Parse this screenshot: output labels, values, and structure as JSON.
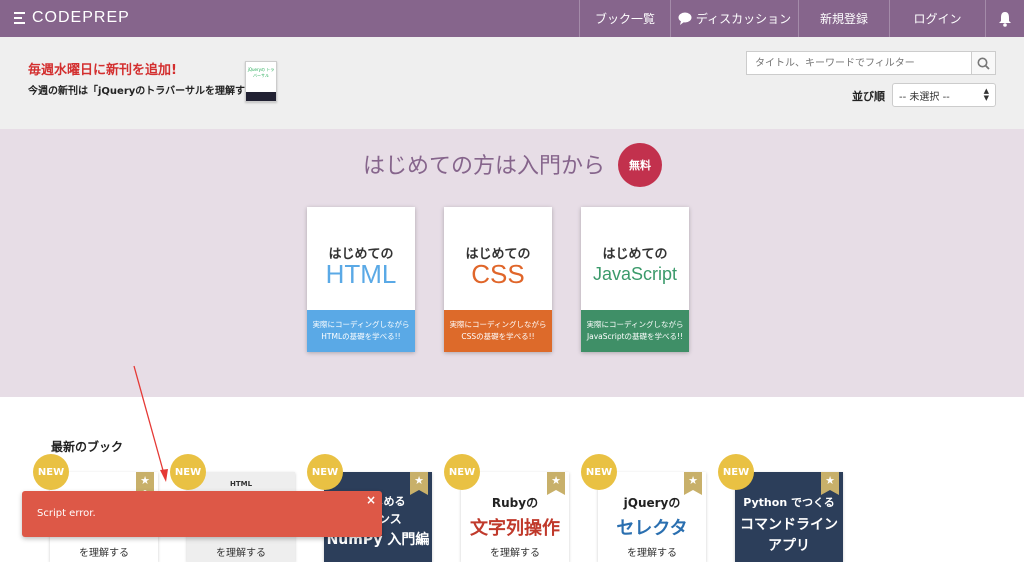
{
  "header": {
    "logo": "CODEPREP",
    "nav": [
      {
        "label": "ブック一覧"
      },
      {
        "label": "ディスカッション"
      },
      {
        "label": "新規登録"
      },
      {
        "label": "ログイン"
      }
    ]
  },
  "promo": {
    "title": "毎週水曜日に新刊を追加!",
    "subtitle": "今週の新刊は「jQueryのトラバーサルを理解する」",
    "book_cover_title": "jQueryの トラバーサル"
  },
  "search": {
    "placeholder": "タイトル、キーワードでフィルター"
  },
  "sort": {
    "label": "並び順",
    "selected": "-- 未選択 --"
  },
  "intro": {
    "title": "はじめての方は入門から",
    "badge": "無料",
    "courses": [
      {
        "prefix": "はじめての",
        "lang": "HTML",
        "desc1": "実際にコーディングしながら",
        "desc2": "HTMLの基礎を学べる!!",
        "color": "#5aa9e6",
        "band": "#5aa9e6"
      },
      {
        "prefix": "はじめての",
        "lang": "CSS",
        "desc1": "実際にコーディングしながら",
        "desc2": "CSSの基礎を学べる!!",
        "color": "#e0662a",
        "band": "#dd6a2a"
      },
      {
        "prefix": "はじめての",
        "lang": "JavaScript",
        "desc1": "実際にコーディングしながら",
        "desc2": "JavaScriptの基礎を学べる!!",
        "color": "#3b9a6b",
        "band": "#3f8f67"
      }
    ]
  },
  "latest": {
    "title": "最新のブック",
    "new_label": "NEW",
    "books": [
      {
        "line1": "",
        "line2": "",
        "line3": "を理解する",
        "bg": "#ffffff",
        "fg": "#333333"
      },
      {
        "line1": "HTML",
        "line2": "",
        "line3": "を理解する",
        "bg": "#eeeeee",
        "fg": "#333333"
      },
      {
        "line1": "ではじめる",
        "line2": "イエンス",
        "line3": "NumPy 入門編",
        "bg": "#2c3e5a",
        "fg": "#ffffff"
      },
      {
        "line1": "Rubyの",
        "line2": "文字列操作",
        "line3": "を理解する",
        "bg": "#ffffff",
        "fg": "#c0392b"
      },
      {
        "line1": "jQueryの",
        "line2": "セレクタ",
        "line3": "を理解する",
        "bg": "#ffffff",
        "fg": "#2a6fb0"
      },
      {
        "line1": "Python でつくる",
        "line2": "コマンドライン",
        "line3": "アプリ",
        "bg": "#2c3e5a",
        "fg": "#ffffff"
      }
    ]
  },
  "toast": {
    "message": "Script error.",
    "close": "×"
  },
  "icons": {
    "star": "★",
    "bell": "bell-icon",
    "chat": "chat-icon",
    "search": "search-icon"
  }
}
